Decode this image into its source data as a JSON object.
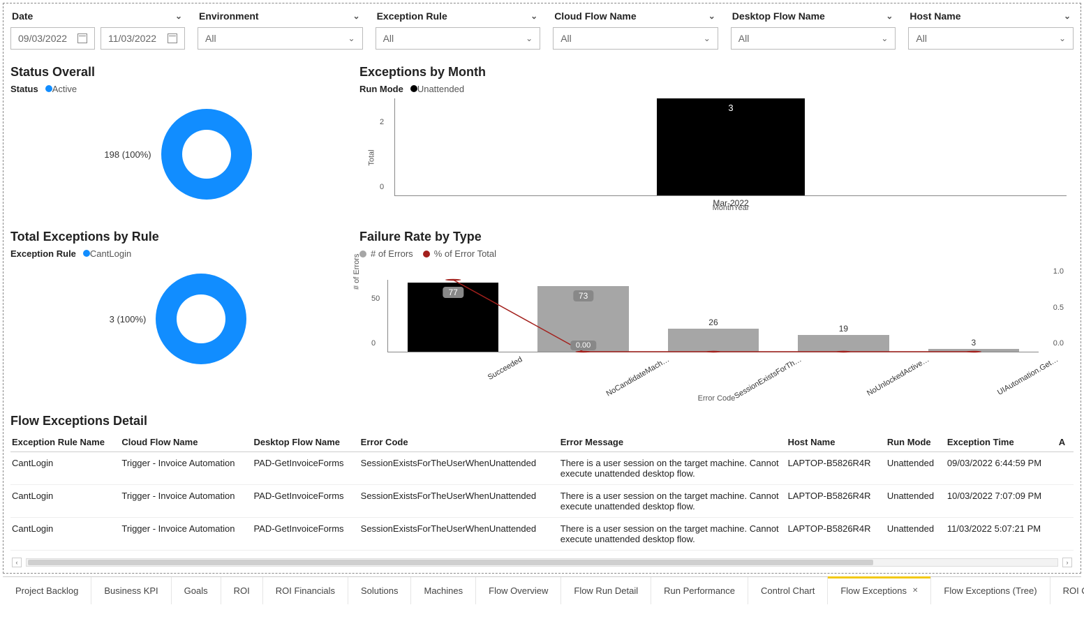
{
  "filters": {
    "date": {
      "label": "Date",
      "start": "09/03/2022",
      "end": "11/03/2022"
    },
    "environment": {
      "label": "Environment",
      "value": "All"
    },
    "exception_rule": {
      "label": "Exception Rule",
      "value": "All"
    },
    "cloud_flow": {
      "label": "Cloud Flow Name",
      "value": "All"
    },
    "desktop_flow": {
      "label": "Desktop Flow Name",
      "value": "All"
    },
    "host": {
      "label": "Host Name",
      "value": "All"
    }
  },
  "status_overall": {
    "title": "Status Overall",
    "legend_title": "Status",
    "legend_items": [
      {
        "label": "Active",
        "color": "#118DFF"
      }
    ],
    "value_label": "198 (100%)"
  },
  "exceptions_by_month": {
    "title": "Exceptions by Month",
    "legend_title": "Run Mode",
    "legend_items": [
      {
        "label": "Unattended",
        "color": "#000000"
      }
    ],
    "x_title": "MonthYear",
    "y_title": "Total",
    "y_ticks": [
      "0",
      "2"
    ]
  },
  "total_exceptions_by_rule": {
    "title": "Total Exceptions by Rule",
    "legend_title": "Exception Rule",
    "legend_items": [
      {
        "label": "CantLogin",
        "color": "#118DFF"
      }
    ],
    "value_label": "3 (100%)"
  },
  "failure_rate": {
    "title": "Failure Rate by Type",
    "legend_items": [
      {
        "label": "# of Errors",
        "color": "#A6A6A6"
      },
      {
        "label": "% of Error Total",
        "color": "#A3201C"
      }
    ],
    "y_title": "# of Errors",
    "x_title": "Error Code",
    "y_ticks": [
      "0",
      "50"
    ],
    "y2_ticks": [
      "0.0",
      "0.5",
      "1.0"
    ],
    "point_label": "0.00"
  },
  "detail": {
    "title": "Flow Exceptions Detail",
    "columns": [
      "Exception Rule Name",
      "Cloud Flow Name",
      "Desktop Flow Name",
      "Error Code",
      "Error Message",
      "Host Name",
      "Run Mode",
      "Exception Time",
      "A"
    ],
    "rows": [
      {
        "rule": "CantLogin",
        "cloud": "Trigger - Invoice Automation",
        "desktop": "PAD-GetInvoiceForms",
        "code": "SessionExistsForTheUserWhenUnattended",
        "msg": "There is a user session on the target machine. Cannot execute unattended desktop flow.",
        "host": "LAPTOP-B5826R4R",
        "mode": "Unattended",
        "time": "09/03/2022 6:44:59 PM"
      },
      {
        "rule": "CantLogin",
        "cloud": "Trigger - Invoice Automation",
        "desktop": "PAD-GetInvoiceForms",
        "code": "SessionExistsForTheUserWhenUnattended",
        "msg": "There is a user session on the target machine. Cannot execute unattended desktop flow.",
        "host": "LAPTOP-B5826R4R",
        "mode": "Unattended",
        "time": "10/03/2022 7:07:09 PM"
      },
      {
        "rule": "CantLogin",
        "cloud": "Trigger - Invoice Automation",
        "desktop": "PAD-GetInvoiceForms",
        "code": "SessionExistsForTheUserWhenUnattended",
        "msg": "There is a user session on the target machine. Cannot execute unattended desktop flow.",
        "host": "LAPTOP-B5826R4R",
        "mode": "Unattended",
        "time": "11/03/2022 5:07:21 PM"
      }
    ]
  },
  "tabs": [
    "Project Backlog",
    "Business KPI",
    "Goals",
    "ROI",
    "ROI Financials",
    "Solutions",
    "Machines",
    "Flow Overview",
    "Flow Run Detail",
    "Run Performance",
    "Control Chart",
    "Flow Exceptions",
    "Flow Exceptions (Tree)",
    "ROI Calculations"
  ],
  "active_tab": "Flow Exceptions",
  "chart_data": [
    {
      "type": "pie",
      "title": "Status Overall",
      "categories": [
        "Active"
      ],
      "values": [
        198
      ],
      "percentages": [
        100
      ]
    },
    {
      "type": "bar",
      "title": "Exceptions by Month",
      "xlabel": "MonthYear",
      "ylabel": "Total",
      "ylim": [
        0,
        3
      ],
      "categories": [
        "Mar-2022"
      ],
      "series": [
        {
          "name": "Unattended",
          "values": [
            3
          ]
        }
      ]
    },
    {
      "type": "pie",
      "title": "Total Exceptions by Rule",
      "categories": [
        "CantLogin"
      ],
      "values": [
        3
      ],
      "percentages": [
        100
      ]
    },
    {
      "type": "bar",
      "title": "Failure Rate by Type",
      "xlabel": "Error Code",
      "ylabel": "# of Errors",
      "y2label": "% of Error Total",
      "ylim": [
        0,
        80
      ],
      "y2lim": [
        0.0,
        1.0
      ],
      "categories": [
        "Succeeded",
        "NoCandidateMach…",
        "SessionExistsForTh…",
        "NoUnlockedActive…",
        "UIAutomation.Get…"
      ],
      "series": [
        {
          "name": "# of Errors",
          "values": [
            77,
            73,
            26,
            19,
            3
          ]
        },
        {
          "name": "% of Error Total",
          "values": [
            1.0,
            0.0,
            0.0,
            0.0,
            0.0
          ]
        }
      ]
    }
  ]
}
